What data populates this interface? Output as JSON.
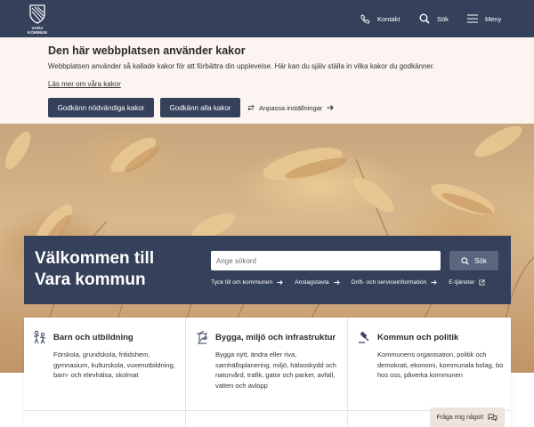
{
  "header": {
    "logo_text": "VARA KOMMUN",
    "nav": {
      "contact": "Kontakt",
      "search": "Sök",
      "menu": "Meny"
    }
  },
  "cookie_banner": {
    "title": "Den här webbplatsen använder kakor",
    "text": "Webbplatsen använder så kallade kakor för att förbättra din upplevelse. Här kan du själv ställa in vilka kakor du godkänner.",
    "read_more": "Läs mer om våra kakor",
    "accept_necessary": "Godkänn nödvändiga kakor",
    "accept_all": "Godkänn alla kakor",
    "customize": "Anpassa inställningar"
  },
  "welcome": {
    "title": "Välkommen till Vara kommun",
    "search_placeholder": "Ange sökord",
    "search_button": "Sök",
    "quick_links": [
      {
        "label": "Tyck till om kommunen",
        "icon": "arrow-right-icon"
      },
      {
        "label": "Anslagstavla",
        "icon": "arrow-right-icon"
      },
      {
        "label": "Drift- och serviceinformation",
        "icon": "arrow-right-icon"
      },
      {
        "label": "E-tjänster",
        "icon": "external-link-icon"
      }
    ]
  },
  "categories": [
    {
      "title": "Barn och utbildning",
      "icon": "children-icon",
      "description": "Förskola, grundskola, fritidshem, gymnasium, kulturskola, vuxenutbildning, barn- och elevhälsa, skolmat"
    },
    {
      "title": "Bygga, miljö och infrastruktur",
      "icon": "crane-icon",
      "description": "Bygga nytt, ändra eller riva, samhällsplanering, miljö, hälsoskydd och naturvård, trafik, gator och parker, avfall, vatten och avlopp"
    },
    {
      "title": "Kommun och politik",
      "icon": "gavel-icon",
      "description": "Kommunens organisation, politik och demokrati, ekonomi, kommunala bolag, bo hos oss, påverka kommunen"
    }
  ],
  "chat": {
    "label": "Fråga mig något!"
  },
  "colors": {
    "primary": "#35405a",
    "banner_bg": "#fbf4f0",
    "search_button": "#59667e"
  }
}
